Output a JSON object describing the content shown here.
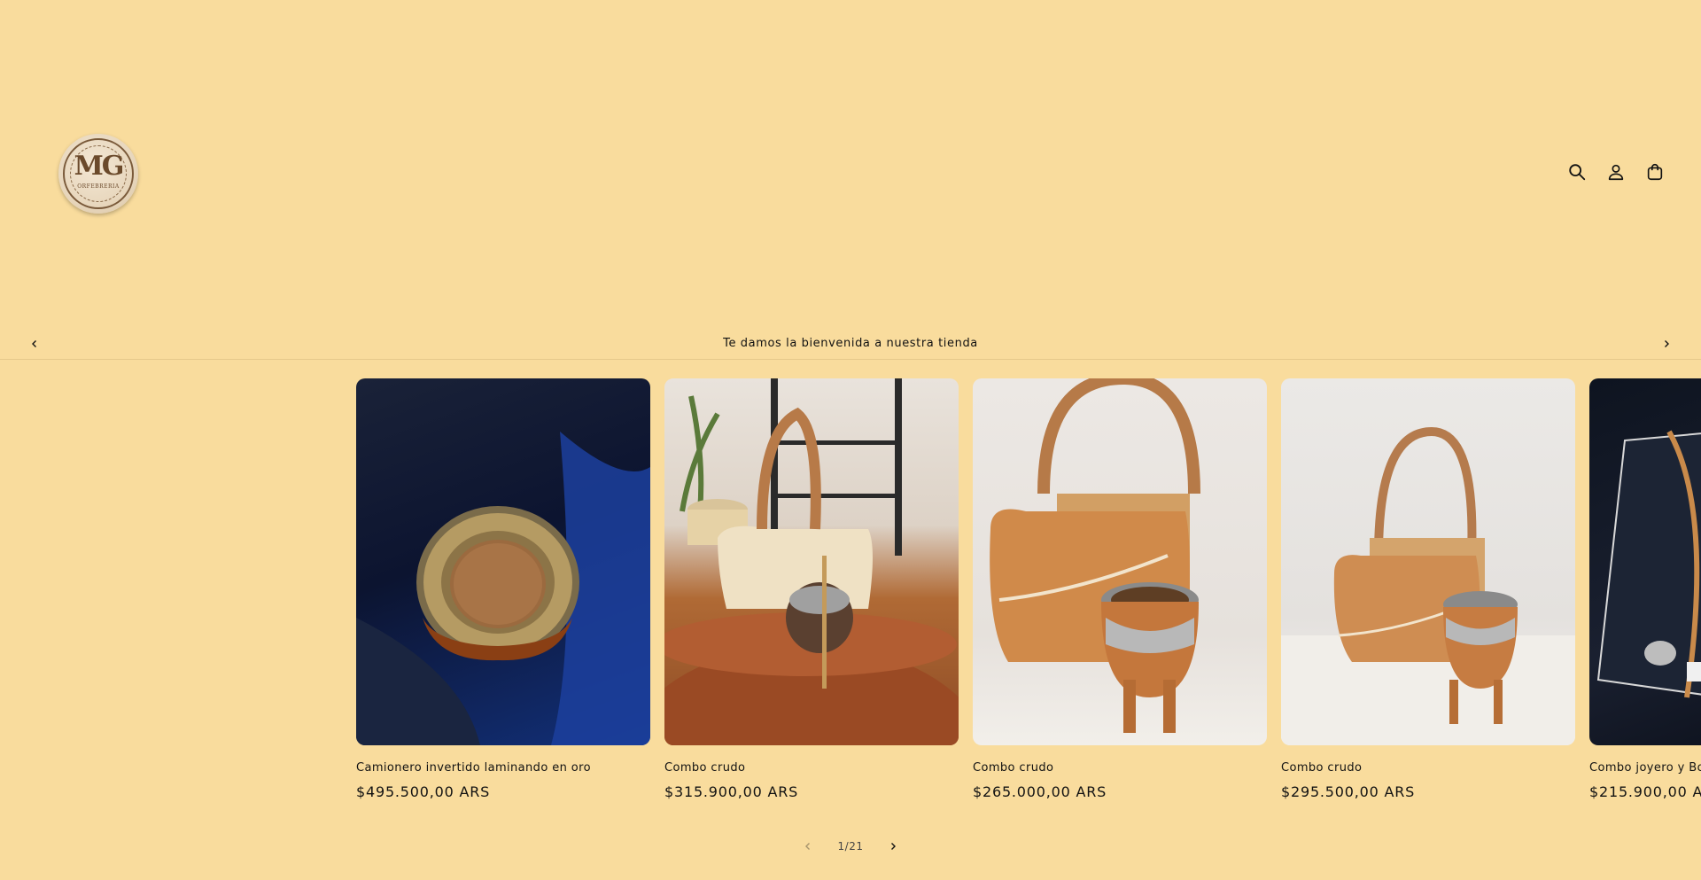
{
  "header": {
    "logo": {
      "monogram": "MG",
      "subtitle": "ORFEBRERIA"
    },
    "icons": [
      "search-icon",
      "account-icon",
      "cart-icon"
    ]
  },
  "announcement": {
    "text": "Te damos la bienvenida a nuestra tienda"
  },
  "products": [
    {
      "title": "Camionero invertido laminando en oro",
      "price": "$495.500,00 ARS"
    },
    {
      "title": "Combo crudo",
      "price": "$315.900,00 ARS"
    },
    {
      "title": "Combo crudo",
      "price": "$265.000,00 ARS"
    },
    {
      "title": "Combo crudo",
      "price": "$295.500,00 ARS"
    },
    {
      "title": "Combo joyero y Bo",
      "price": "$215.900,00 AR"
    }
  ],
  "pagination": {
    "counter": "1/21"
  },
  "colors": {
    "background": "#f9dc9d",
    "text": "#121212",
    "divider": "#e6c98b"
  }
}
